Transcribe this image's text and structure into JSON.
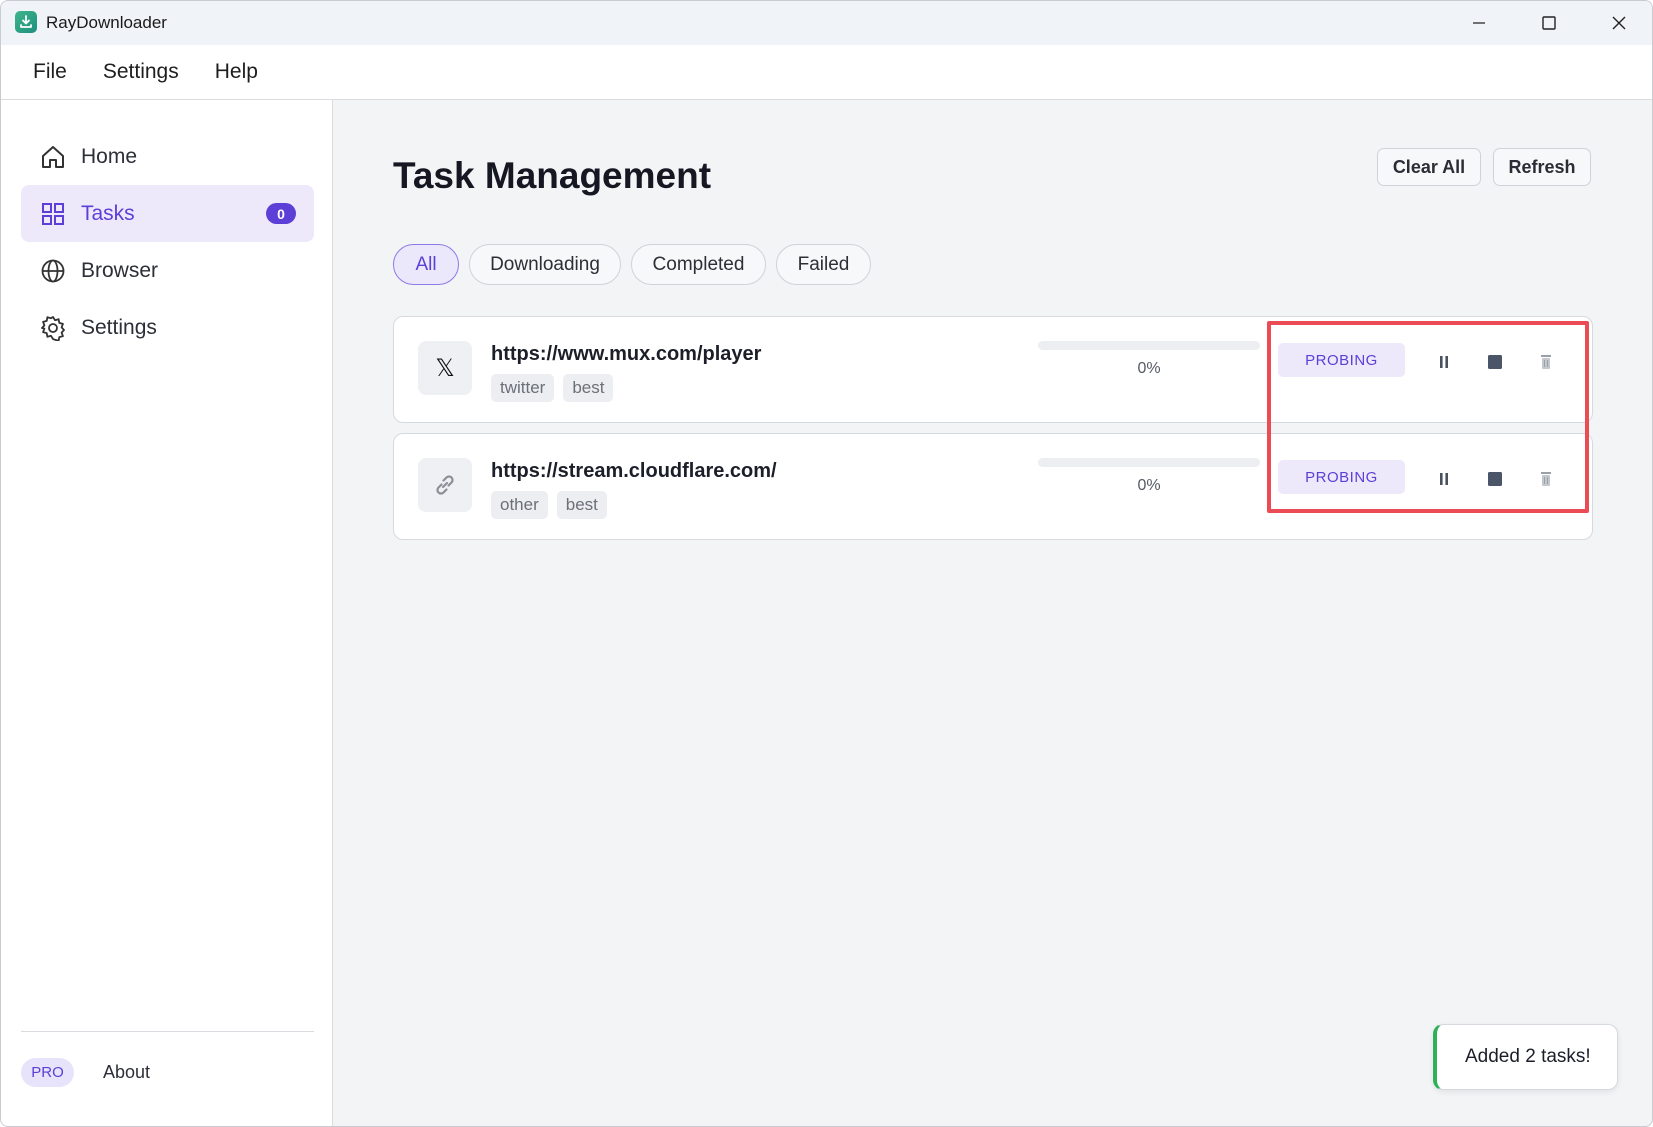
{
  "window": {
    "title": "RayDownloader",
    "icon": "download-app-icon",
    "controls": [
      "minimize-icon",
      "maximize-icon",
      "close-icon"
    ]
  },
  "menu": {
    "items": [
      "File",
      "Settings",
      "Help"
    ]
  },
  "sidebar": {
    "items": [
      {
        "label": "Home",
        "icon": "home-icon",
        "active": false
      },
      {
        "label": "Tasks",
        "icon": "grid-icon",
        "active": true,
        "badge": "0"
      },
      {
        "label": "Browser",
        "icon": "globe-icon",
        "active": false
      },
      {
        "label": "Settings",
        "icon": "gear-icon",
        "active": false
      }
    ],
    "pro_label": "PRO",
    "about_label": "About"
  },
  "main": {
    "title": "Task Management",
    "buttons": {
      "clear_all": "Clear All",
      "refresh": "Refresh"
    },
    "filters": [
      {
        "label": "All",
        "active": true
      },
      {
        "label": "Downloading",
        "active": false
      },
      {
        "label": "Completed",
        "active": false
      },
      {
        "label": "Failed",
        "active": false
      }
    ],
    "tasks": [
      {
        "thumb_icon": "x-logo-icon",
        "thumb_text": "𝕏",
        "url": "https://www.mux.com/player",
        "tags": [
          "twitter",
          "best"
        ],
        "progress_percent": 0,
        "progress_text": "0%",
        "status": "PROBING"
      },
      {
        "thumb_icon": "link-icon",
        "url": "https://stream.cloudflare.com/",
        "tags": [
          "other",
          "best"
        ],
        "progress_percent": 0,
        "progress_text": "0%",
        "status": "PROBING"
      }
    ]
  },
  "toast": {
    "message": "Added 2 tasks!",
    "accent": "#2fb05b"
  },
  "colors": {
    "accent": "#5b3fd6",
    "highlight": "#ea4b55"
  }
}
